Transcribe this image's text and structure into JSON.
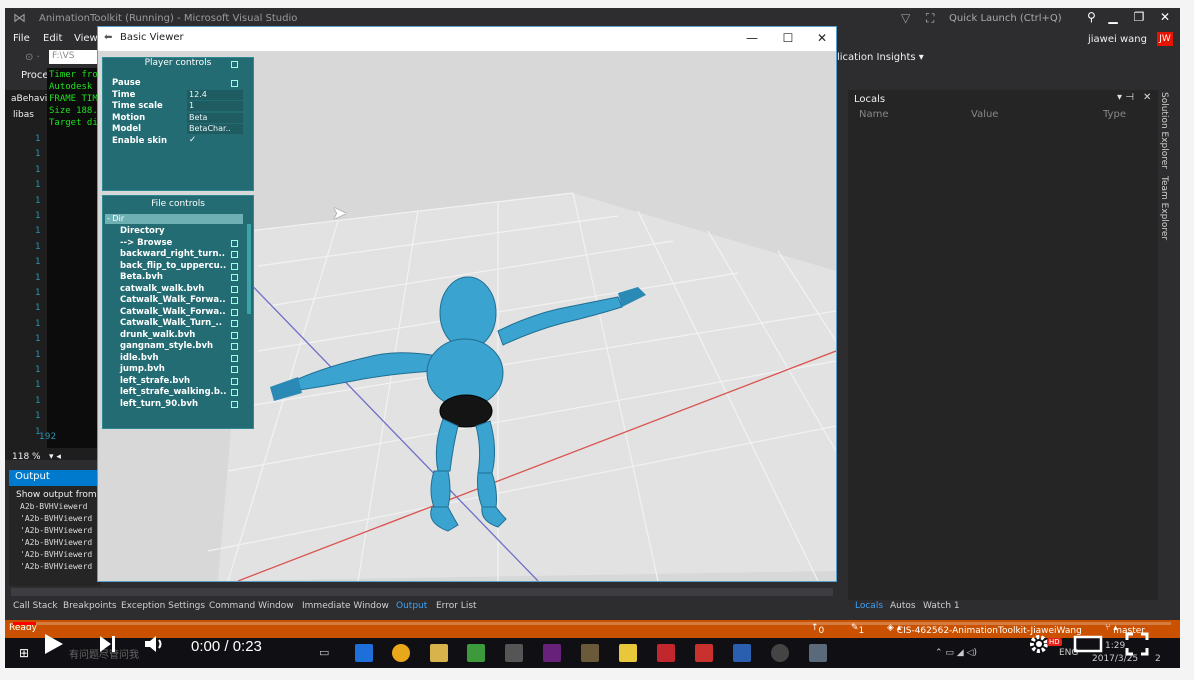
{
  "vs": {
    "title": "AnimationToolkit (Running) - Microsoft Visual Studio",
    "quick_launch": "Quick Launch (Ctrl+Q)",
    "user": "jiawei wang",
    "user_initials": "JW",
    "menu": [
      "File",
      "Edit",
      "View"
    ],
    "app_insights": "lication Insights",
    "process_label": "Proce",
    "tab_file": "F:\\VS",
    "editor_label": "aBehavi",
    "editor_file": "libas",
    "zoom": "118 %",
    "line_end": "192"
  },
  "console": {
    "lines": [
      "Timer fro",
      "Autodesk",
      "FRAME TIM",
      "Size 188.",
      "Target di"
    ]
  },
  "output": {
    "title": "Output",
    "from": "Show output from",
    "lines": [
      "A2b-BVHViewerd",
      "'A2b-BVHViewerd",
      "'A2b-BVHViewerd",
      "'A2b-BVHViewerd",
      "'A2b-BVHViewerd",
      "'A2b-BVHViewerd"
    ]
  },
  "bottom_tabs": [
    "Call Stack",
    "Breakpoints",
    "Exception Settings",
    "Command Window",
    "Immediate Window",
    "Output",
    "Error List"
  ],
  "right_tabs": [
    "Locals",
    "Autos",
    "Watch 1"
  ],
  "locals": {
    "title": "Locals",
    "columns": [
      "Name",
      "Value",
      "Type"
    ],
    "side_tabs": [
      "Solution Explorer",
      "Team Explorer"
    ]
  },
  "status": {
    "ready": "Ready",
    "up": "0",
    "edits": "1",
    "repo": "CIS-462562-AnimationToolkit-JiaweiWang",
    "branch": "master"
  },
  "taskbar": {
    "search": "有问题尽管问我",
    "lang": "ENG",
    "time": "1:29",
    "date": "2017/3/25",
    "notif_count": "2"
  },
  "video": {
    "time": "0:00 / 0:23",
    "progress": 0.02,
    "hd": "HD"
  },
  "viewer": {
    "title": "Basic Viewer",
    "player_controls": {
      "title": "Player controls",
      "rows": [
        {
          "label": "Pause",
          "value": ""
        },
        {
          "label": "Time",
          "value": "12.4"
        },
        {
          "label": "Time scale",
          "value": "1"
        },
        {
          "label": "Motion",
          "value": "Beta"
        },
        {
          "label": "Model",
          "value": "BetaChar.."
        },
        {
          "label": "Enable skin",
          "value": "✓"
        }
      ]
    },
    "file_controls": {
      "title": "File controls",
      "dir": "- Dir",
      "items": [
        "Directory",
        "--> Browse",
        "backward_right_turn..",
        "back_flip_to_uppercu..",
        "Beta.bvh",
        "catwalk_walk.bvh",
        "Catwalk_Walk_Forwa..",
        "Catwalk_Walk_Forwa..",
        "Catwalk_Walk_Turn_..",
        "drunk_walk.bvh",
        "gangnam_style.bvh",
        "idle.bvh",
        "jump.bvh",
        "left_strafe.bvh",
        "left_strafe_walking.b..",
        "left_turn_90.bvh"
      ]
    }
  },
  "colors": {
    "vs_dark": "#2d2d30",
    "accent": "#007acc",
    "status": "#ca5100",
    "panel": "#236c73",
    "character": "#3aa3d0"
  }
}
